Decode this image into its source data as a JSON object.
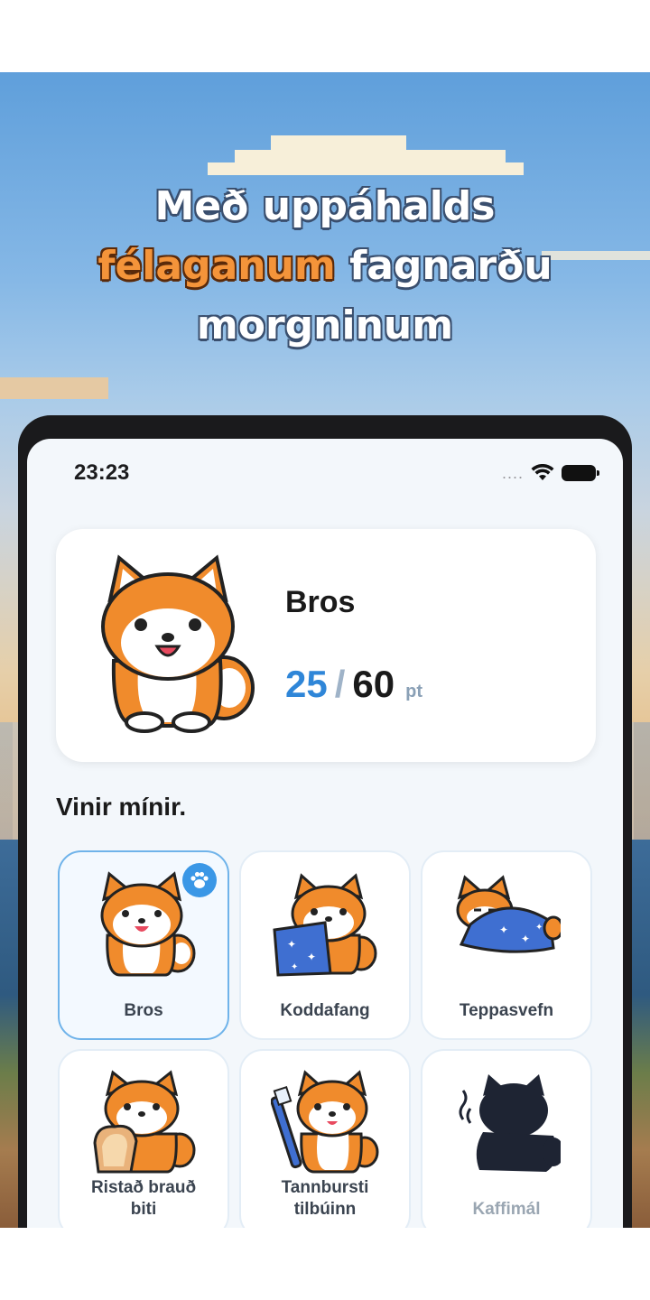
{
  "headline": {
    "line1": "Með uppáhalds",
    "highlight": "félaganum",
    "line2_rest": " fagnarðu",
    "line3": "morgninum"
  },
  "status_bar": {
    "time": "23:23",
    "signal": "....",
    "icons": [
      "wifi-icon",
      "battery-icon"
    ]
  },
  "profile": {
    "name": "Bros",
    "points_current": "25",
    "points_separator": "/",
    "points_max": "60",
    "points_unit": "pt"
  },
  "friends": {
    "title": "Vinir mínir.",
    "items": [
      {
        "label": "Bros",
        "selected": true,
        "locked": false,
        "icon": "shiba-smile-icon"
      },
      {
        "label": "Koddafang",
        "selected": false,
        "locked": false,
        "icon": "shiba-pillow-icon"
      },
      {
        "label": "Teppasvefn",
        "selected": false,
        "locked": false,
        "icon": "shiba-blanket-icon"
      },
      {
        "label": "Ristað brauð\nbiti",
        "selected": false,
        "locked": false,
        "icon": "shiba-toast-icon"
      },
      {
        "label": "Tannbursti\ntilbúinn",
        "selected": false,
        "locked": false,
        "icon": "shiba-toothbrush-icon"
      },
      {
        "label": "Kaffimál",
        "selected": false,
        "locked": true,
        "icon": "locked-silhouette-icon"
      }
    ]
  },
  "colors": {
    "accent_blue": "#2f86d8",
    "highlight_orange": "#f4943a",
    "card_bg": "#ffffff",
    "screen_bg": "#f3f7fb"
  }
}
